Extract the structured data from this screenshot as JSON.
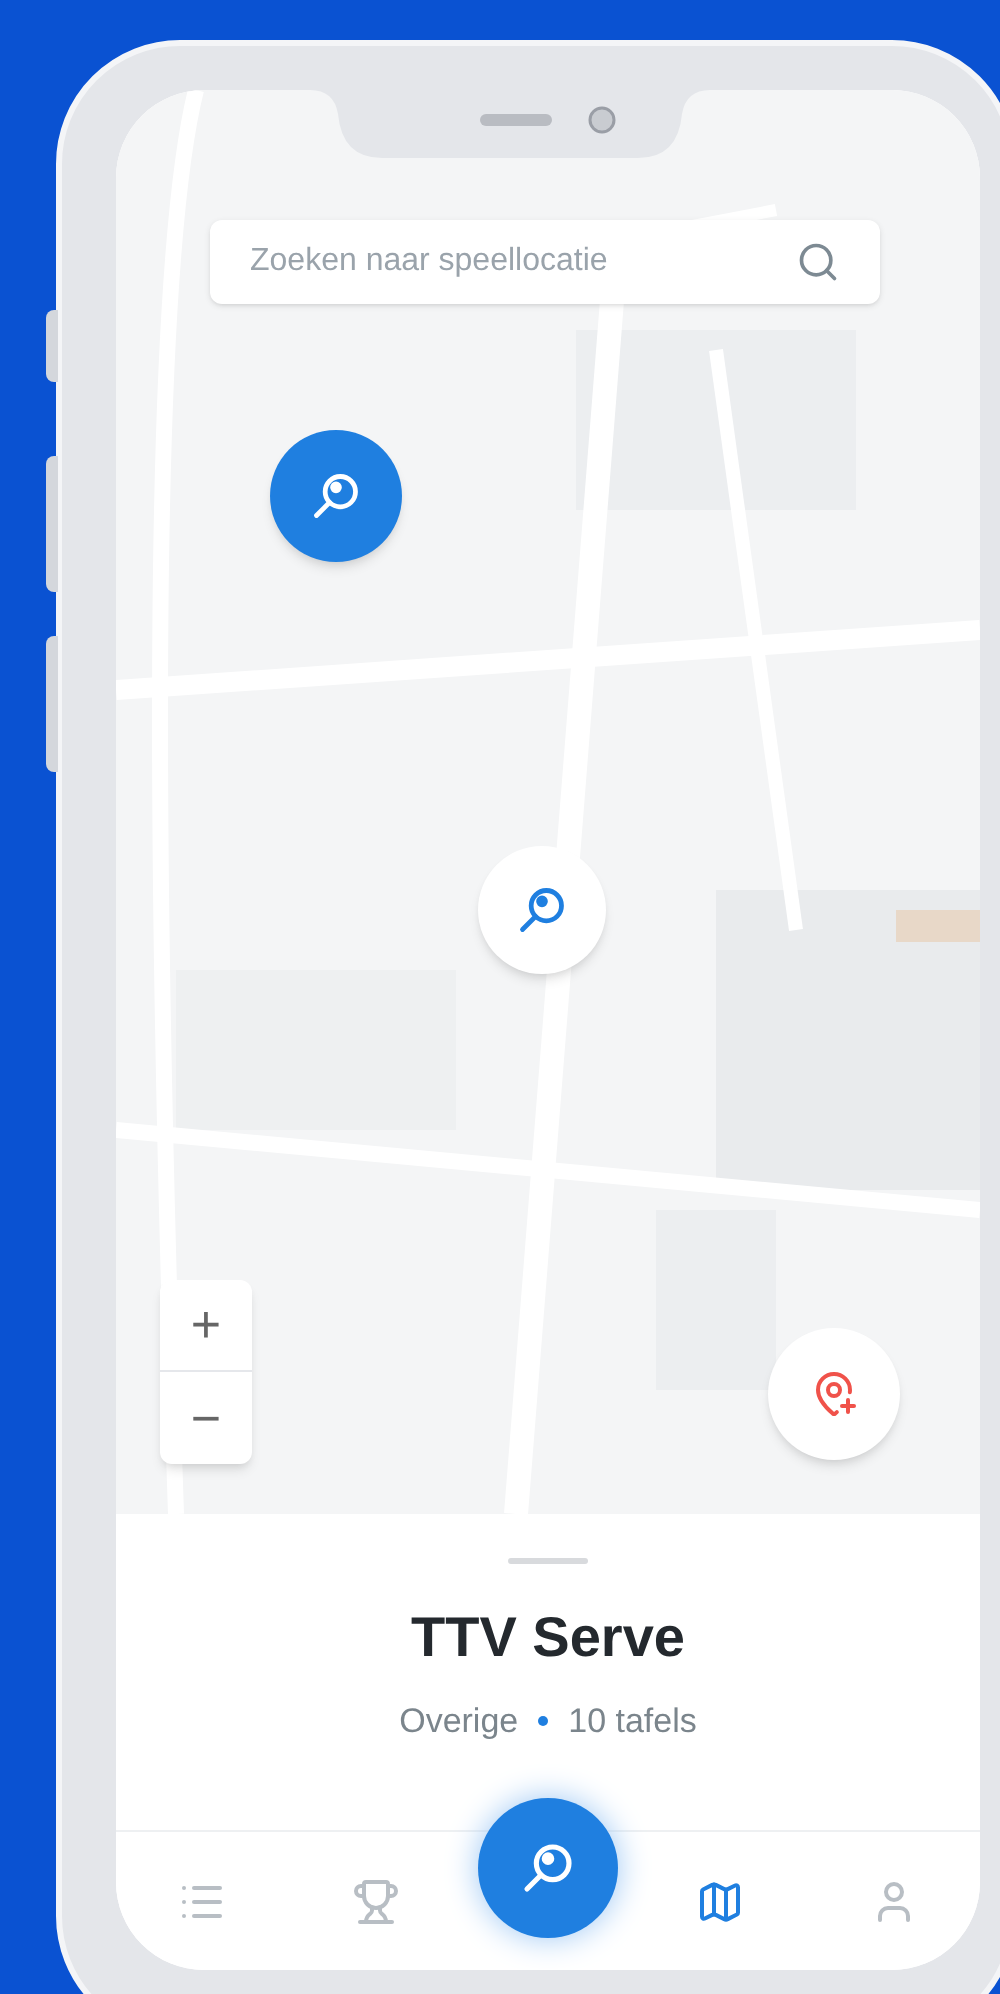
{
  "search": {
    "placeholder": "Zoeken naar speellocatie"
  },
  "markers": [
    {
      "selected": true
    },
    {
      "selected": false
    }
  ],
  "zoom": {
    "in": "+",
    "out": "−"
  },
  "location": {
    "title": "TTV Serve",
    "category": "Overige",
    "tables": "10 tafels"
  },
  "nav": [
    {
      "kind": "list",
      "selected": false
    },
    {
      "kind": "trophy",
      "selected": false
    },
    {
      "kind": "center",
      "selected": false
    },
    {
      "kind": "map",
      "selected": true
    },
    {
      "kind": "profile",
      "selected": false
    }
  ]
}
